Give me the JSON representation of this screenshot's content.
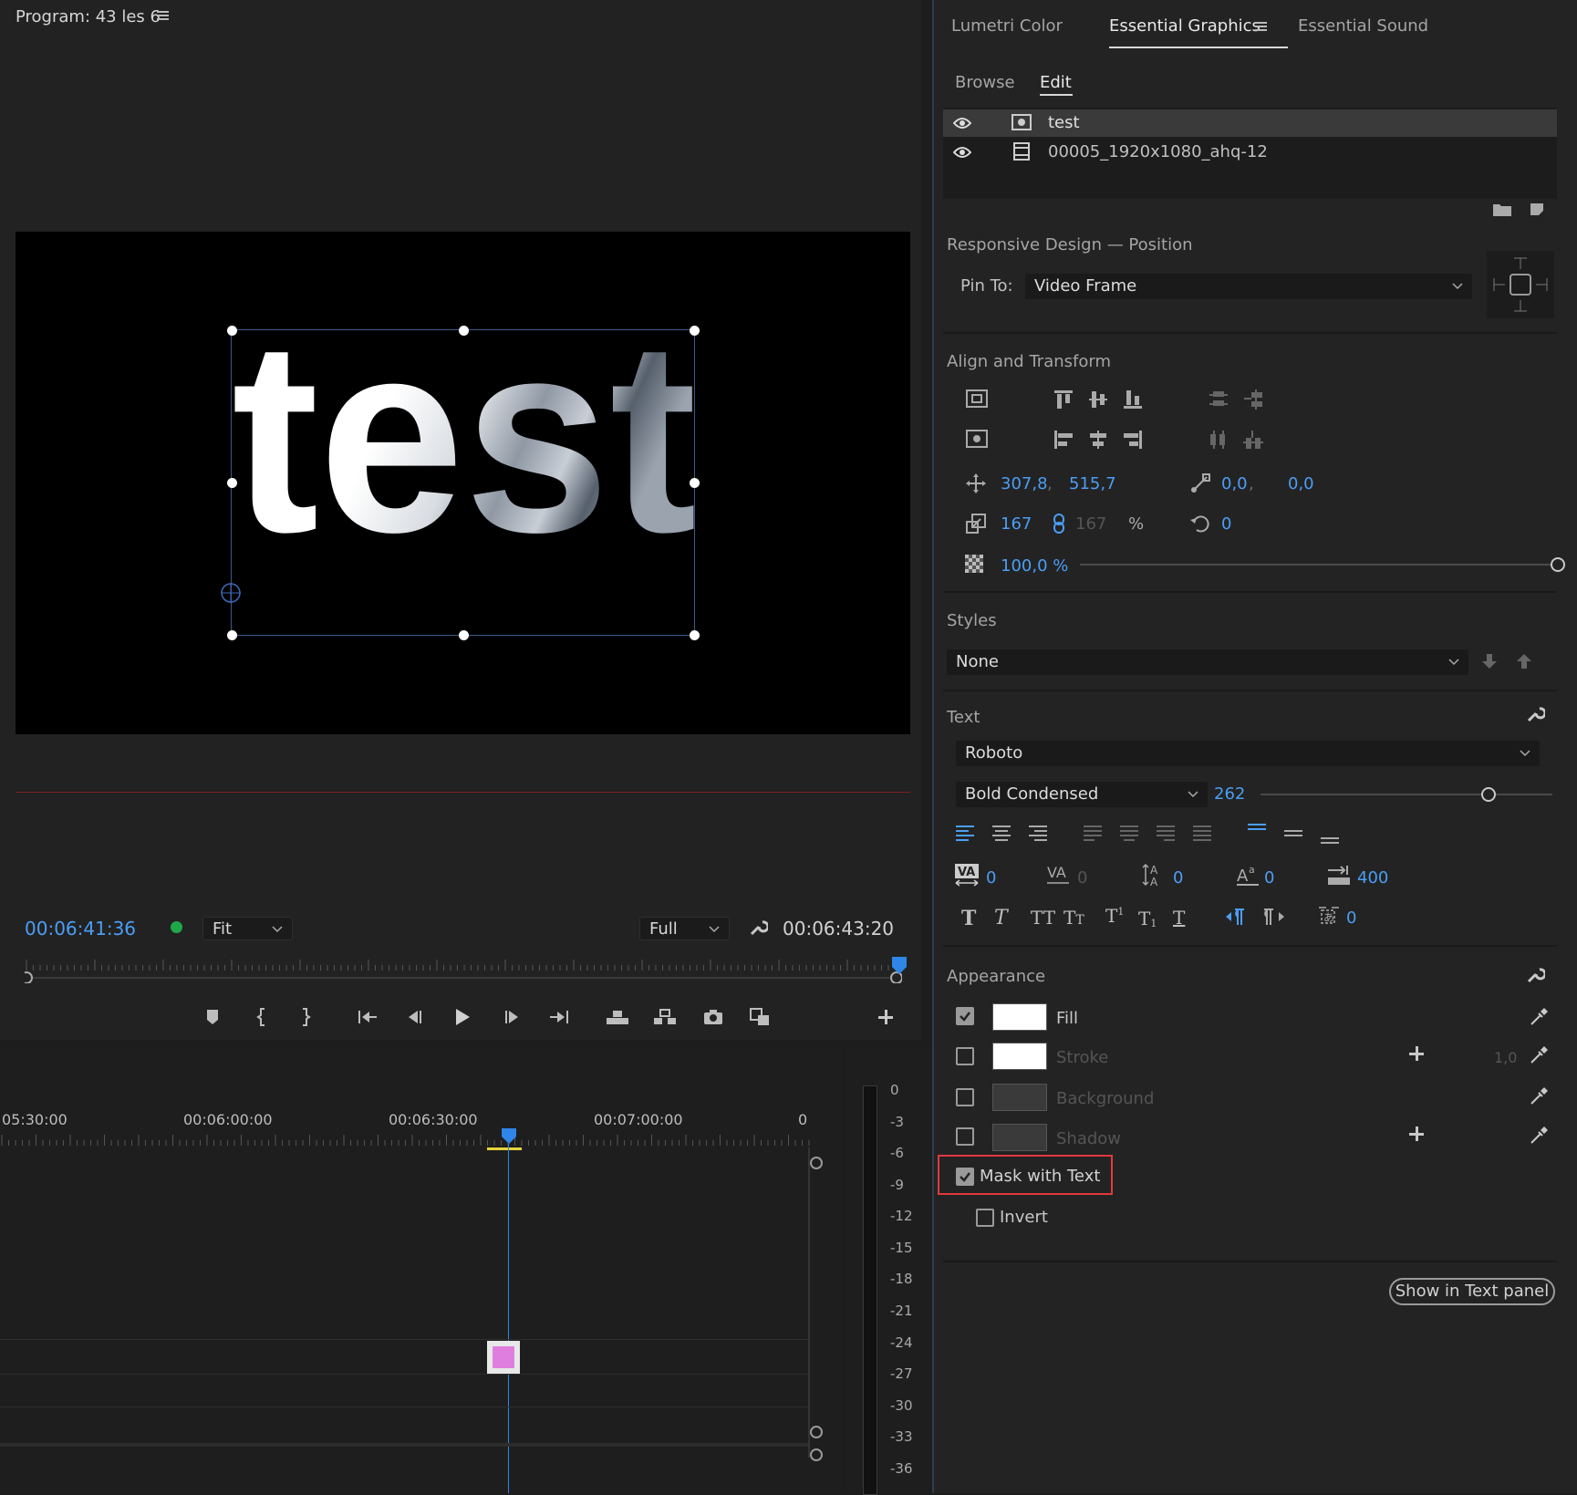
{
  "program": {
    "title": "Program: 43 les 6",
    "canvas_text": "test",
    "timecode_current": "00:06:41:36",
    "fit_label": "Fit",
    "quality_label": "Full",
    "timecode_duration": "00:06:43:20",
    "colors": {
      "timecode": "#4b9ef5",
      "status_dot": "#1ea84a"
    }
  },
  "timeline": {
    "ruler_labels": [
      "05:30:00",
      "00:06:00:00",
      "00:06:30:00",
      "00:07:00:00",
      "0"
    ],
    "clip_color": "#e07ee0"
  },
  "audio_meter": {
    "scale": [
      "0",
      "-3",
      "-6",
      "-9",
      "-12",
      "-15",
      "-18",
      "-21",
      "-24",
      "-27",
      "-30",
      "-33",
      "-36"
    ]
  },
  "panel": {
    "tabs": [
      "Lumetri Color",
      "Essential Graphics",
      "Essential Sound"
    ],
    "active_tab": "Essential Graphics",
    "subtabs": [
      "Browse",
      "Edit"
    ],
    "active_subtab": "Edit",
    "layers": [
      {
        "name": "test",
        "type": "text"
      },
      {
        "name": "00005_1920x1080_ahq-12",
        "type": "video"
      }
    ],
    "responsive": {
      "title": "Responsive Design — Position",
      "pin_label": "Pin To:",
      "pin_value": "Video Frame"
    },
    "align": {
      "title": "Align and Transform",
      "pos_x": "307,8",
      "pos_y": "515,7",
      "anchor_x": "0,0",
      "anchor_y": "0,0",
      "scale": "167",
      "scale_linked": "167",
      "scale_unit": "%",
      "rotation": "0",
      "opacity": "100,0 %",
      "opacity_level": 1.0
    },
    "styles": {
      "title": "Styles",
      "value": "None"
    },
    "text": {
      "title": "Text",
      "font": "Roboto",
      "style": "Bold Condensed",
      "size": "262",
      "size_level": 0.78,
      "kerning": "0",
      "tracking": "0",
      "leading": "0",
      "baseline": "0",
      "tab_width": "400",
      "tsume": "0"
    },
    "appearance": {
      "title": "Appearance",
      "fill": {
        "label": "Fill",
        "checked": true,
        "color": "#ffffff"
      },
      "stroke": {
        "label": "Stroke",
        "checked": false,
        "color": "#ffffff",
        "width": "1,0"
      },
      "background": {
        "label": "Background",
        "checked": false,
        "color": "#3a3a3a"
      },
      "shadow": {
        "label": "Shadow",
        "checked": false,
        "color": "#3a3a3a"
      },
      "mask": {
        "label": "Mask with Text",
        "checked": true
      },
      "invert": {
        "label": "Invert",
        "checked": false
      },
      "highlight_color": "#e0393e"
    },
    "show_text_panel": "Show in Text panel"
  }
}
